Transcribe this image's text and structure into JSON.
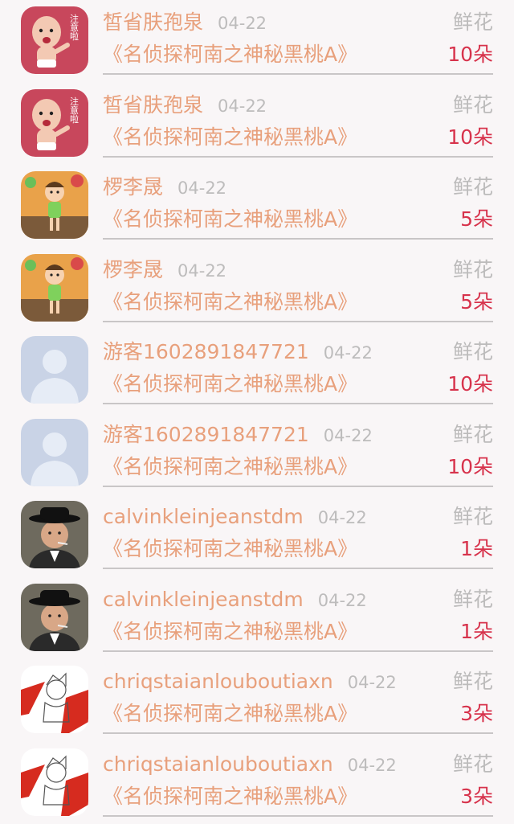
{
  "records": [
    {
      "username": "皙省肤孢泉",
      "date": "04-22",
      "gift": "鲜花",
      "title": "《名侦探柯南之神秘黑桃A》",
      "quantity": "10朵",
      "avatar": "baby-sticker-avatar",
      "avatar_badge": "注意啦"
    },
    {
      "username": "皙省肤孢泉",
      "date": "04-22",
      "gift": "鲜花",
      "title": "《名侦探柯南之神秘黑桃A》",
      "quantity": "10朵",
      "avatar": "baby-sticker-avatar",
      "avatar_badge": "注意啦"
    },
    {
      "username": "椤李晟",
      "date": "04-22",
      "gift": "鲜花",
      "title": "《名侦探柯南之神秘黑桃A》",
      "quantity": "5朵",
      "avatar": "cartoon-kid-avatar"
    },
    {
      "username": "椤李晟",
      "date": "04-22",
      "gift": "鲜花",
      "title": "《名侦探柯南之神秘黑桃A》",
      "quantity": "5朵",
      "avatar": "cartoon-kid-avatar"
    },
    {
      "username": "游客1602891847721",
      "date": "04-22",
      "gift": "鲜花",
      "title": "《名侦探柯南之神秘黑桃A》",
      "quantity": "10朵",
      "avatar": "default-user-avatar"
    },
    {
      "username": "游客1602891847721",
      "date": "04-22",
      "gift": "鲜花",
      "title": "《名侦探柯南之神秘黑桃A》",
      "quantity": "10朵",
      "avatar": "default-user-avatar"
    },
    {
      "username": "calvinkleinjeanstdm",
      "date": "04-22",
      "gift": "鲜花",
      "title": "《名侦探柯南之神秘黑桃A》",
      "quantity": "1朵",
      "avatar": "man-in-hat-avatar"
    },
    {
      "username": "calvinkleinjeanstdm",
      "date": "04-22",
      "gift": "鲜花",
      "title": "《名侦探柯南之神秘黑桃A》",
      "quantity": "1朵",
      "avatar": "man-in-hat-avatar"
    },
    {
      "username": "chriqstaianlouboutiaxn",
      "date": "04-22",
      "gift": "鲜花",
      "title": "《名侦探柯南之神秘黑桃A》",
      "quantity": "3朵",
      "avatar": "sketch-red-avatar"
    },
    {
      "username": "chriqstaianlouboutiaxn",
      "date": "04-22",
      "gift": "鲜花",
      "title": "《名侦探柯南之神秘黑桃A》",
      "quantity": "3朵",
      "avatar": "sketch-red-avatar"
    }
  ],
  "colors": {
    "background": "#f9f6f7",
    "name_and_title": "#e8a07c",
    "meta_gray": "#bdbcbc",
    "quantity_red": "#d7334c",
    "divider": "#c9c6c7"
  }
}
